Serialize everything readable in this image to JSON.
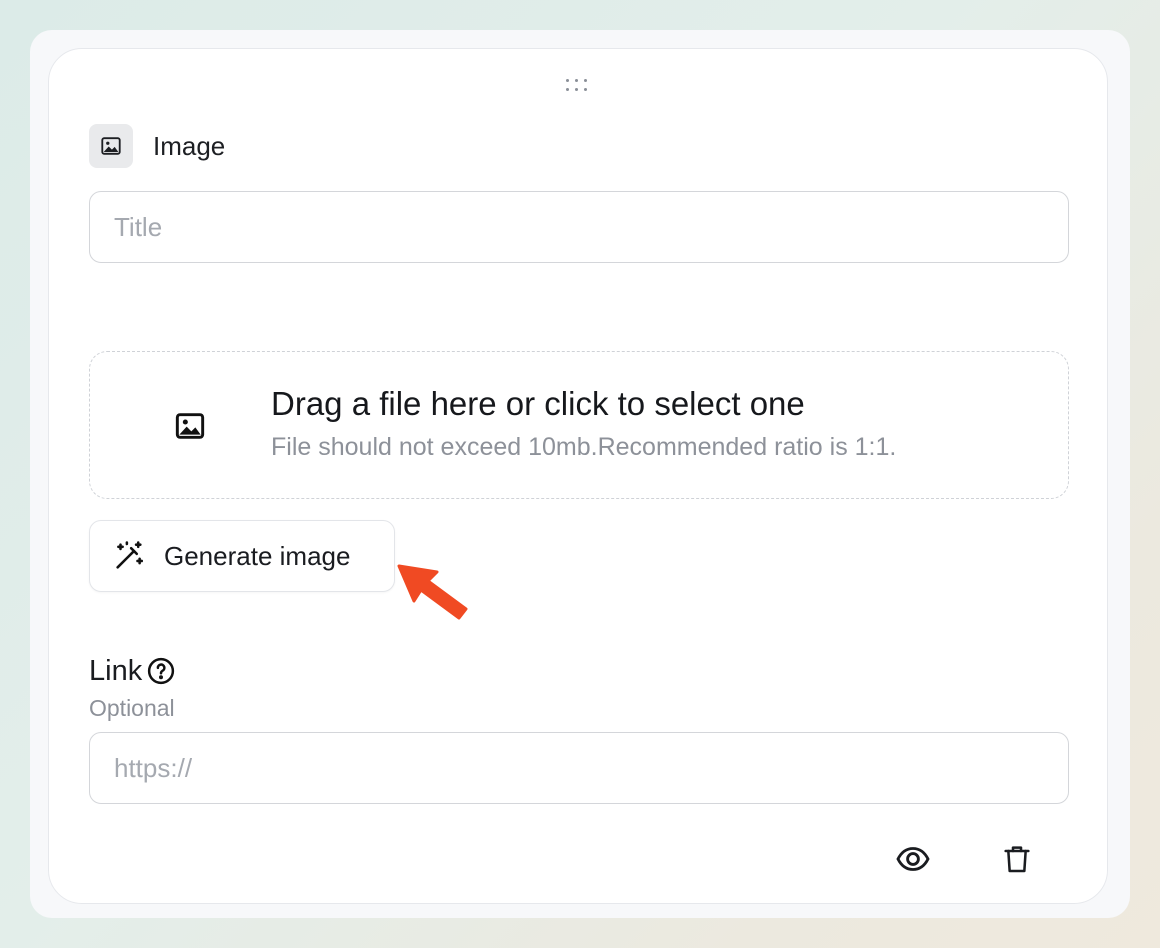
{
  "block": {
    "icon": "image-icon",
    "title": "Image"
  },
  "title_input": {
    "value": "",
    "placeholder": "Title"
  },
  "dropzone": {
    "icon": "image-icon",
    "main_text": "Drag a file here or click to select one",
    "sub_text": "File should not exceed 10mb.Recommended ratio is 1:1."
  },
  "generate_button": {
    "icon": "magic-wand-icon",
    "label": "Generate image"
  },
  "annotation": {
    "icon": "arrow-pointer",
    "color": "#f04a23"
  },
  "link": {
    "label": "Link",
    "help_icon": "question-circle-icon",
    "optional_label": "Optional",
    "value": "",
    "placeholder": "https://"
  },
  "actions": {
    "preview_icon": "eye-icon",
    "delete_icon": "trash-icon"
  }
}
